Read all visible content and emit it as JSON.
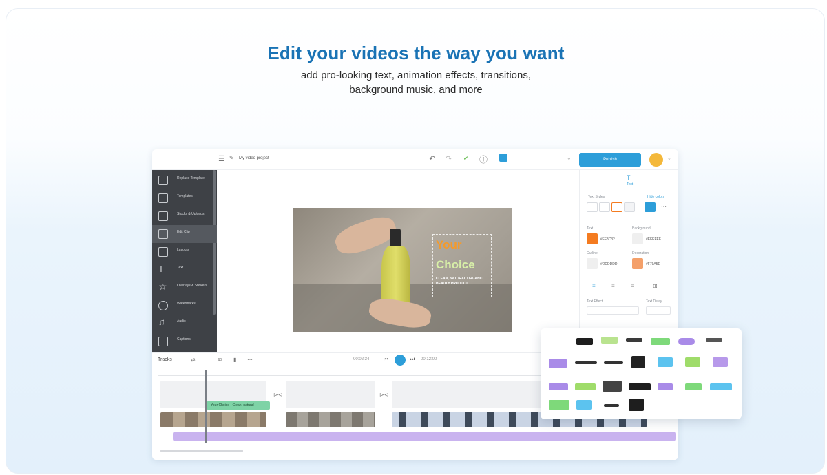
{
  "hero": {
    "headline": "Edit your videos the way you want",
    "subline_1": "add pro-looking text, animation effects, transitions,",
    "subline_2": "background music, and more"
  },
  "editor": {
    "project_name": "My video project",
    "publish_label": "Publish",
    "sidebar": [
      {
        "label": "Replace Template",
        "active": false
      },
      {
        "label": "Templates",
        "active": false
      },
      {
        "label": "Stocks & Uploads",
        "active": false
      },
      {
        "label": "Edit Clip",
        "active": true
      },
      {
        "label": "Layouts",
        "active": false
      },
      {
        "label": "Text",
        "active": false
      },
      {
        "label": "Overlays & Stickers",
        "active": false
      },
      {
        "label": "Watermarks",
        "active": false
      },
      {
        "label": "Audio",
        "active": false
      },
      {
        "label": "Captions",
        "active": false
      }
    ],
    "video_text": {
      "line1": "Your",
      "line2": "Choice",
      "small": "CLEAN, NATURAL ORGANIC BEAUTY PRODUCT"
    },
    "right_panel": {
      "tab": "Text",
      "styles_label": "Text Styles",
      "hide_colors": "Hide colors",
      "text_label": "Text",
      "background_label": "Background",
      "outline_label": "Outline",
      "decoration_label": "Decoration",
      "text_hex": "#FF8C32",
      "background_hex": "#EFEFEF",
      "outline_hex": "#DDDDDD",
      "decoration_hex": "#F79A5E",
      "effect_label": "Text Effect",
      "delay_label": "Text Delay",
      "colors": {
        "orange": "#f47b20",
        "light": "#efefef",
        "peach": "#f4a06a"
      }
    },
    "timeline": {
      "tracks_label": "Tracks",
      "time_current": "00:02:34",
      "time_total": "00:12:00",
      "green_clip_label": "Your Choice - Clean, natural"
    }
  },
  "presets_popover": {
    "colors": [
      "#1e1e1e",
      "#b9e38f",
      "#7ed97a",
      "#a98be8",
      "#5cc3ef",
      "#9fdc6a",
      "#b799ea"
    ]
  }
}
